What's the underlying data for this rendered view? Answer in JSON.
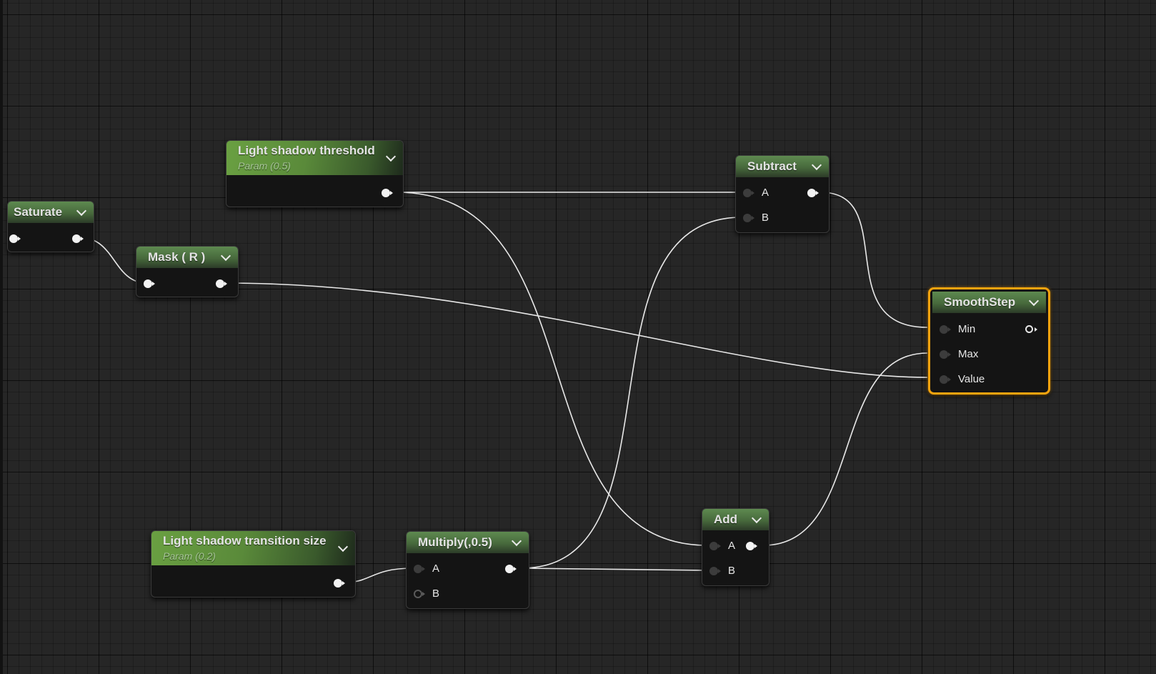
{
  "nodes": {
    "saturate": {
      "title": "Saturate"
    },
    "mask": {
      "title": "Mask ( R )"
    },
    "threshold": {
      "title": "Light shadow threshold",
      "subtitle": "Param (0.5)"
    },
    "transition": {
      "title": "Light shadow transition size",
      "subtitle": "Param (0.2)"
    },
    "multiply": {
      "title": "Multiply(,0.5)",
      "inputs": [
        "A",
        "B"
      ]
    },
    "subtract": {
      "title": "Subtract",
      "inputs": [
        "A",
        "B"
      ]
    },
    "add": {
      "title": "Add",
      "inputs": [
        "A",
        "B"
      ]
    },
    "smoothstep": {
      "title": "SmoothStep",
      "inputs": [
        "Min",
        "Max",
        "Value"
      ]
    }
  },
  "colors": {
    "background": "#262626",
    "node_header": "#47693c",
    "param_header": "#6aa042",
    "selection": "#f5a30e",
    "wire": "#e8e8e8"
  }
}
